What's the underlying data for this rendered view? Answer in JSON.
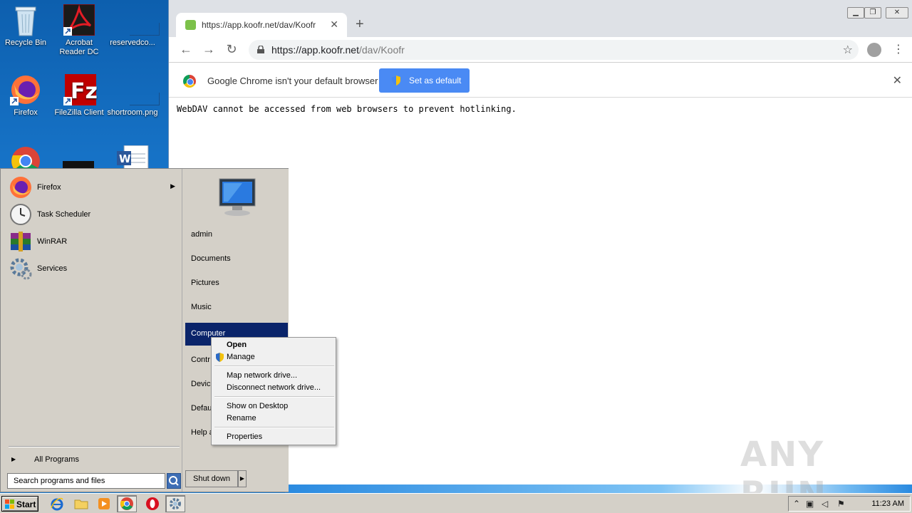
{
  "desktop": {
    "icons": [
      {
        "label": "Recycle Bin"
      },
      {
        "label": "Acrobat Reader DC"
      },
      {
        "label": "reservedco..."
      },
      {
        "label": "Firefox"
      },
      {
        "label": "FileZilla Client"
      },
      {
        "label": "shortroom.png"
      }
    ]
  },
  "browser": {
    "tab_title": "https://app.koofr.net/dav/Koofr",
    "url_host": "https://app.koofr.net",
    "url_path": "/dav/Koofr",
    "infobar_message": "Google Chrome isn't your default browser",
    "infobar_button": "Set as default",
    "page_text": "WebDAV cannot be accessed from web browsers to prevent hotlinking."
  },
  "start_menu": {
    "programs": [
      {
        "label": "Firefox",
        "has_submenu": true
      },
      {
        "label": "Task Scheduler"
      },
      {
        "label": "WinRAR"
      },
      {
        "label": "Services"
      }
    ],
    "all_programs": "All Programs",
    "search_placeholder": "Search programs and files",
    "places": [
      {
        "label": "admin"
      },
      {
        "label": "Documents"
      },
      {
        "label": "Pictures"
      },
      {
        "label": "Music"
      },
      {
        "label": "Computer"
      },
      {
        "label": "Contr"
      },
      {
        "label": "Device"
      },
      {
        "label": "Defau"
      },
      {
        "label": "Help a"
      }
    ],
    "shutdown": "Shut down"
  },
  "context_menu": {
    "items": [
      {
        "label": "Open",
        "bold": true
      },
      {
        "label": "Manage"
      },
      {
        "label": "Map network drive..."
      },
      {
        "label": "Disconnect network drive..."
      },
      {
        "label": "Show on Desktop"
      },
      {
        "label": "Rename"
      },
      {
        "label": "Properties"
      }
    ]
  },
  "taskbar": {
    "start_label": "Start",
    "clock": "11:23 AM"
  },
  "watermark": "ANY RUN",
  "colors": {
    "highlight": "#0a246a",
    "chrome_button": "#4a8af4",
    "desktop_bg": "#1a7ad0"
  }
}
